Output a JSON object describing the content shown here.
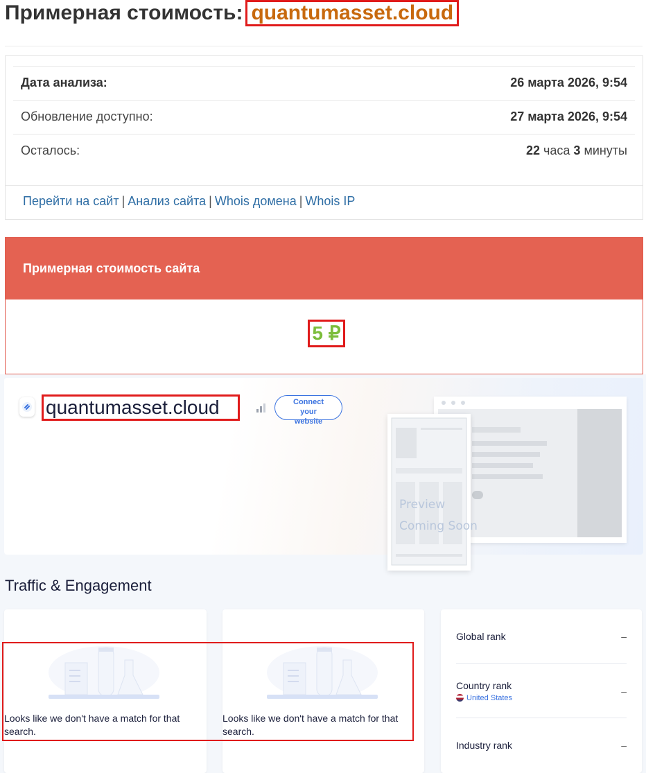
{
  "header": {
    "title_prefix": "Примерная стоимость:",
    "domain": "quantumasset.cloud"
  },
  "analysis": {
    "rows": [
      {
        "label": "Дата анализа:",
        "value": "26 марта 2026, 9:54"
      },
      {
        "label": "Обновление доступно:",
        "value": "27 марта 2026, 9:54"
      }
    ],
    "remaining": {
      "label": "Осталось:",
      "hours": "22",
      "hours_unit": "часа",
      "minutes": "3",
      "minutes_unit": "минуты"
    }
  },
  "links": [
    "Перейти на сайт",
    "Анализ сайта",
    "Whois домена",
    "Whois IP"
  ],
  "cost": {
    "header": "Примерная стоимость сайта",
    "value": "5 ₽"
  },
  "similarweb": {
    "domain": "quantumasset.cloud",
    "connect_label_1": "Connect",
    "connect_label_2": "your",
    "connect_label_3": "website",
    "preview_line_1": "Preview",
    "preview_line_2": "Coming Soon",
    "traffic_title": "Traffic & Engagement",
    "empty_message": "Looks like we don't have a match for that search.",
    "ranks": [
      {
        "label": "Global rank",
        "value": "–"
      },
      {
        "label": "Country rank",
        "sub": "United States",
        "value": "–"
      },
      {
        "label": "Industry rank",
        "value": "–"
      }
    ]
  },
  "colors": {
    "accent_red": "#e46252",
    "domain_orange": "#c8690d",
    "value_green": "#7cbd3b",
    "link_blue": "#2f6ea5",
    "highlight_red": "#e01b1b"
  }
}
